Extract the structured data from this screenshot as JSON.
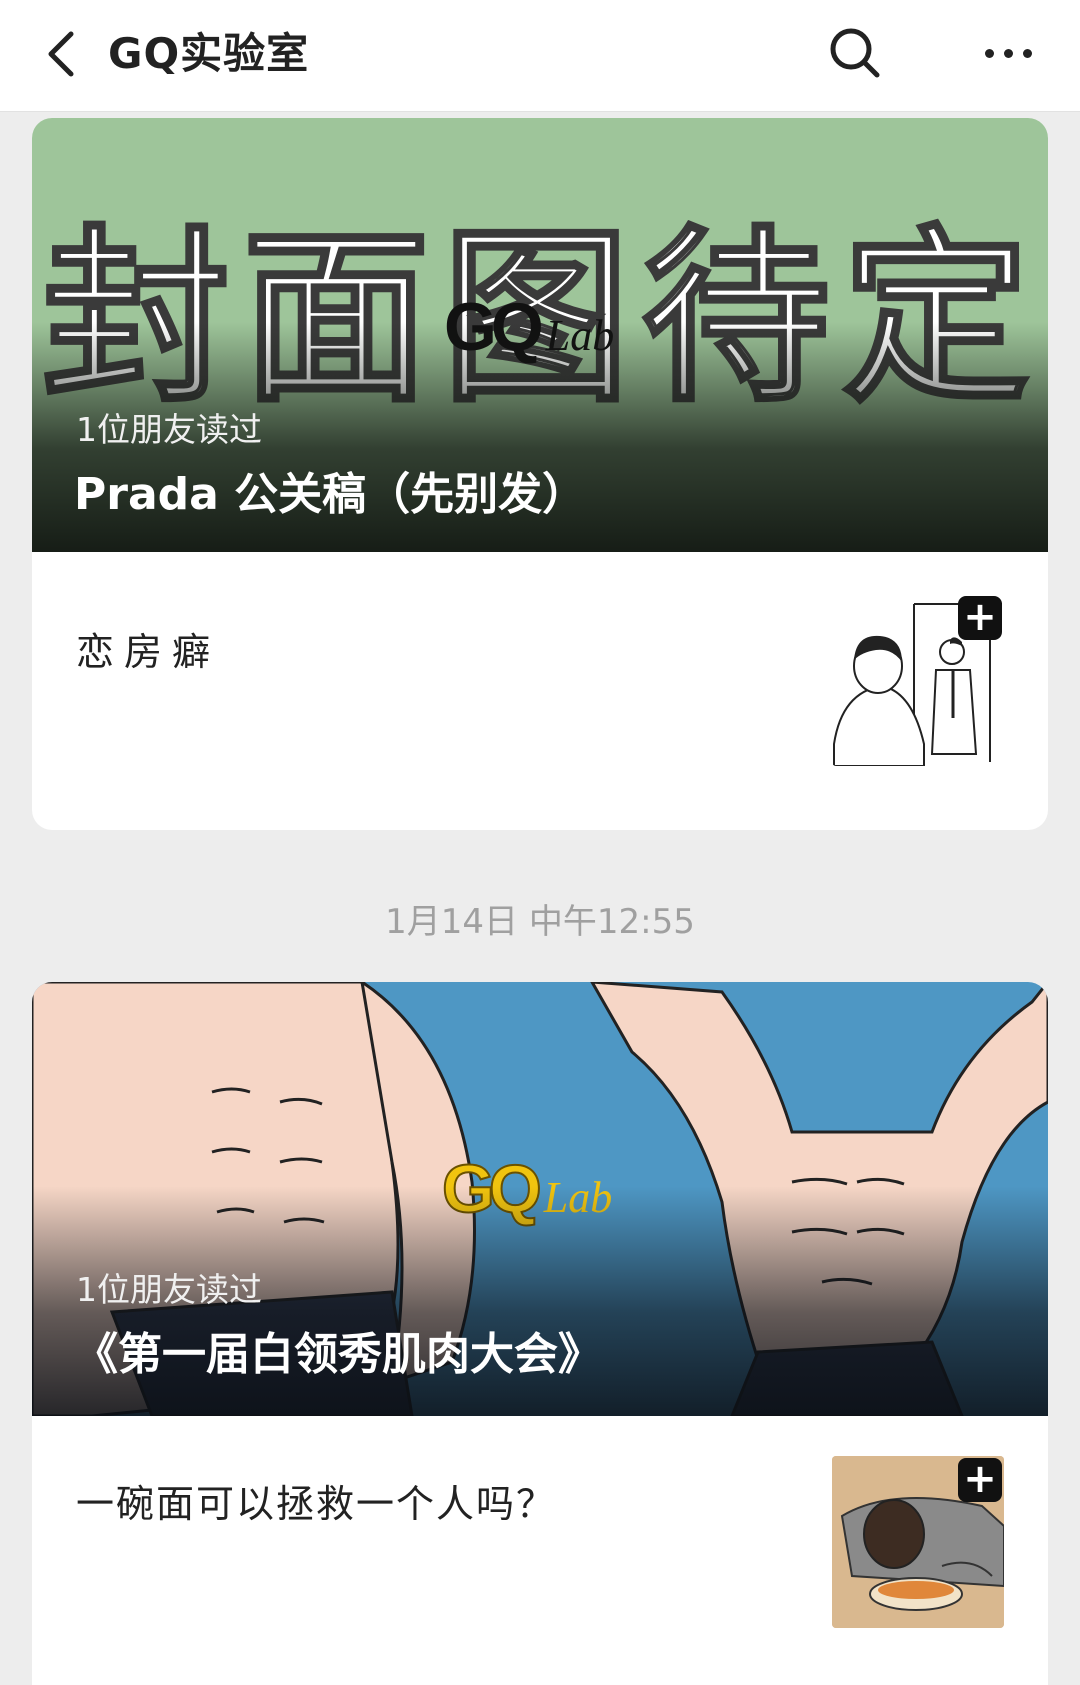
{
  "header": {
    "title": "GQ实验室",
    "back_icon": "chevron-left-icon",
    "search_icon": "search-icon",
    "more_icon": "more-dots-icon"
  },
  "articles": [
    {
      "cover": {
        "text": "封面图待定",
        "logo_main": "GQ",
        "logo_sub": "Lab",
        "readers": "1位朋友读过",
        "headline": "Prada 公关稿（先别发）"
      },
      "item": {
        "title": "恋房癖",
        "badge": "+"
      }
    },
    {
      "cover": {
        "logo_main": "GQ",
        "logo_sub": "Lab",
        "readers": "1位朋友读过",
        "headline": "《第一届白领秀肌肉大会》"
      },
      "item": {
        "title": "一碗面可以拯救一个人吗？",
        "badge": "+"
      }
    }
  ],
  "timestamp": "1月14日 中午12:55",
  "colors": {
    "cover1_bg": "#9ec59a",
    "cover2_bg": "#4e97c4",
    "logo_yellow": "#f1c40f",
    "page_bg": "#ededed"
  }
}
